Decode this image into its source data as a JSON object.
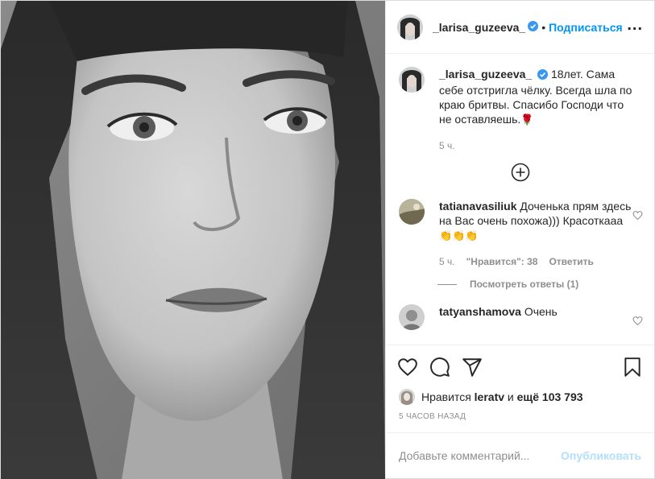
{
  "header": {
    "username": "_larisa_guzeeva_",
    "separator": "•",
    "follow_label": "Подписаться",
    "more_label": "..."
  },
  "caption": {
    "username": "_larisa_guzeeva_",
    "text": "18лет. Сама себе отстригла чёлку. Всегда шла по краю бритвы. Спасибо Господи что не оставляешь.",
    "emoji": "🌹",
    "time": "5 ч."
  },
  "load_more": {
    "icon": "plus-circle-icon"
  },
  "comments": [
    {
      "username": "tatianavasiliuk",
      "text": "Доченька прям здесь на Вас очень похожа))) Красоткааа",
      "emoji": "👏👏👏",
      "time": "5 ч.",
      "likes": "\"Нравится\": 38",
      "reply_label": "Ответить",
      "view_replies": "Посмотреть ответы (1)"
    },
    {
      "username": "tatyanshamova",
      "text": "Очень"
    }
  ],
  "actions": {
    "like_icon": "heart-icon",
    "comment_icon": "comment-icon",
    "share_icon": "paper-plane-icon",
    "save_icon": "bookmark-icon"
  },
  "likes": {
    "prefix": "Нравится",
    "user": "leratv",
    "middle": "и",
    "rest": "ещё 103 793"
  },
  "posted_ago": "5 ЧАСОВ НАЗАД",
  "add_comment": {
    "placeholder": "Добавьте комментарий...",
    "publish_label": "Опубликовать"
  },
  "colors": {
    "accent": "#0095f6",
    "publish_disabled": "#b2dffc",
    "verified": "#3897f0",
    "muted": "#8e8e8e"
  }
}
